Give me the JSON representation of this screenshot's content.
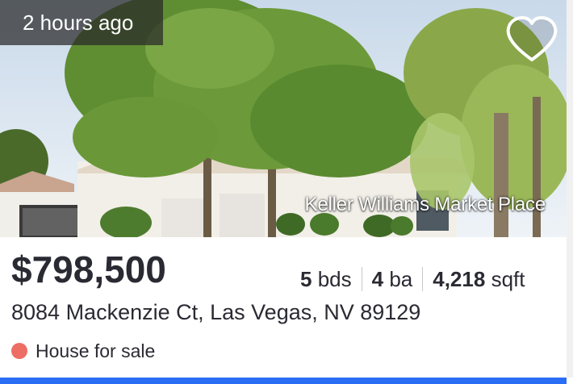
{
  "listing": {
    "time_ago": "2 hours ago",
    "brokerage": "Keller Williams Market Place",
    "price": "$798,500",
    "beds_value": "5",
    "beds_unit": "bds",
    "baths_value": "4",
    "baths_unit": "ba",
    "sqft_value": "4,218",
    "sqft_unit": "sqft",
    "address": "8084 Mackenzie Ct, Las Vegas, NV 89129",
    "status_text": "House for sale"
  },
  "icons": {
    "favorite": "heart-outline-icon"
  },
  "colors": {
    "status_dot": "#ec6e64",
    "accent_bar": "#2b6ef6",
    "text": "#2a2a33"
  }
}
